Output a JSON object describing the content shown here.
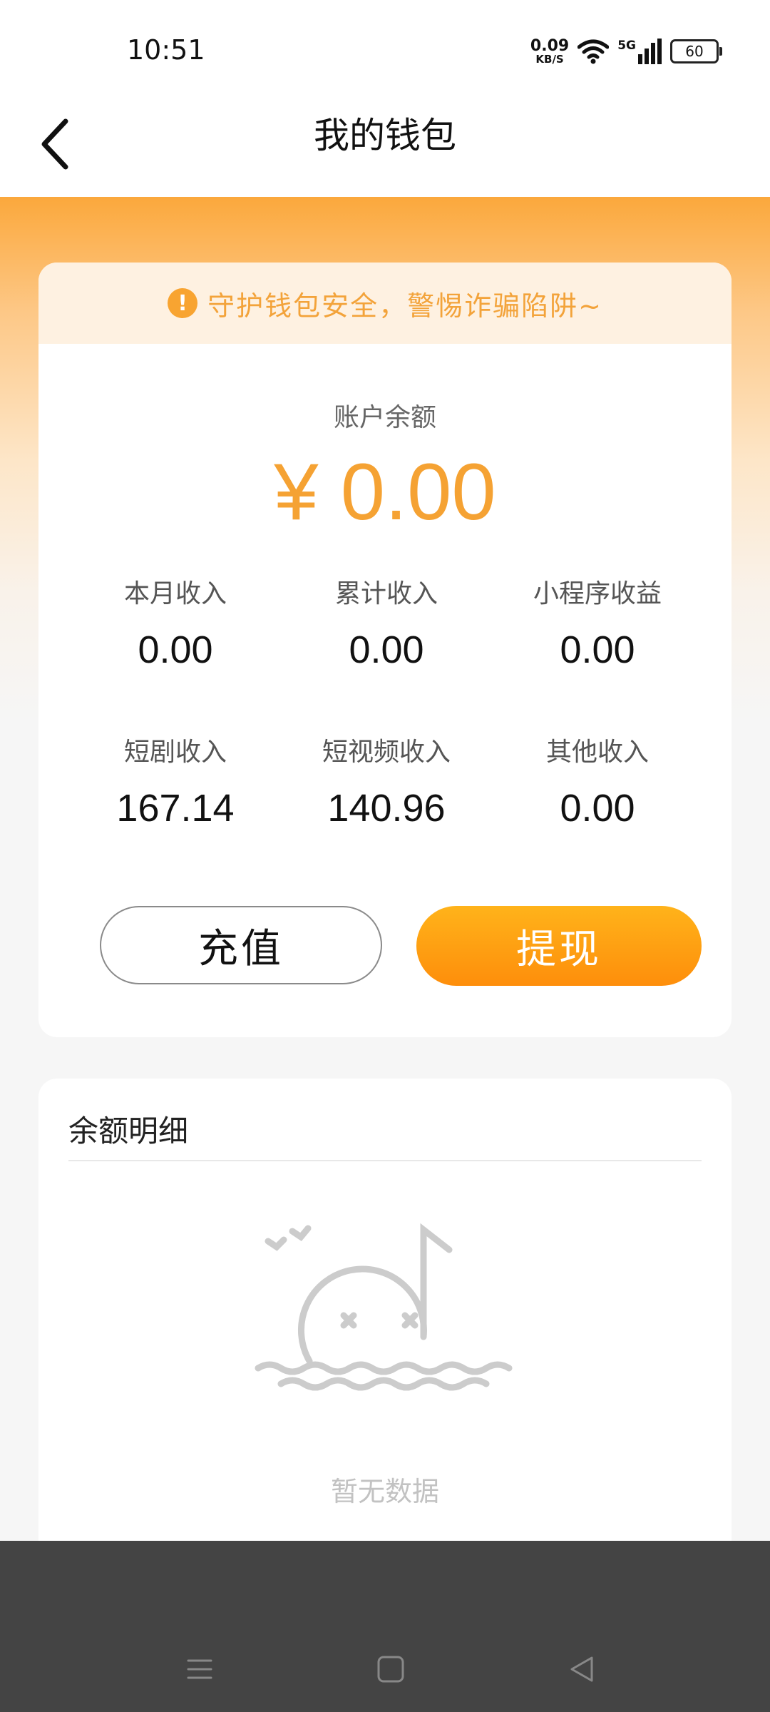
{
  "status_bar": {
    "time": "10:51",
    "net_speed_value": "0.09",
    "net_speed_unit": "KB/S",
    "network": "5G",
    "battery": "60",
    "icons": [
      "wifi-icon",
      "signal-icon",
      "battery-icon"
    ]
  },
  "header": {
    "title": "我的钱包",
    "back_icon": "chevron-left-icon"
  },
  "wallet": {
    "notice": "守护钱包安全，警惕诈骗陷阱~",
    "notice_icon": "exclamation-icon",
    "balance_label": "账户余额",
    "balance_amount": "¥ 0.00",
    "stats": [
      {
        "label": "本月收入",
        "value": "0.00"
      },
      {
        "label": "累计收入",
        "value": "0.00"
      },
      {
        "label": "小程序收益",
        "value": "0.00"
      },
      {
        "label": "短剧收入",
        "value": "167.14"
      },
      {
        "label": "短视频收入",
        "value": "140.96"
      },
      {
        "label": "其他收入",
        "value": "0.00"
      }
    ],
    "recharge_label": "充值",
    "withdraw_label": "提现"
  },
  "detail": {
    "title": "余额明细",
    "empty_text": "暂无数据",
    "empty_icon": "empty-music-note-illustration"
  },
  "nav_bar": {
    "icons": [
      "menu-icon",
      "home-square-icon",
      "back-triangle-icon"
    ]
  },
  "colors": {
    "accent": "#f5a233",
    "button_gradient_start": "#ffb31a",
    "button_gradient_end": "#fe8e0b",
    "notice_bg": "#fef1e1",
    "nav_bg": "#444444"
  }
}
